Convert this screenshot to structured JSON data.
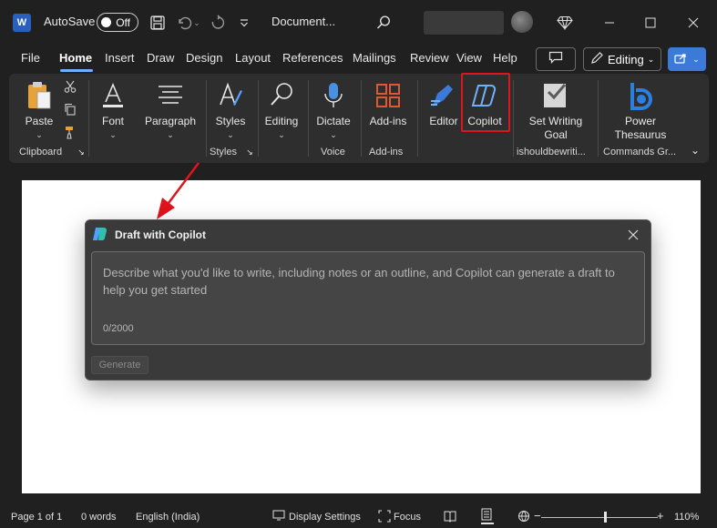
{
  "titlebar": {
    "app_logo": "W",
    "autosave_label": "AutoSave",
    "autosave_state": "Off",
    "doc_title": "Document...",
    "icons": [
      "save-icon",
      "undo-icon",
      "redo-icon",
      "customize-qat-icon",
      "search-icon",
      "premium-diamond-icon",
      "minimize-icon",
      "maximize-icon",
      "close-icon"
    ]
  },
  "tabs": [
    "File",
    "Home",
    "Insert",
    "Draw",
    "Design",
    "Layout",
    "References",
    "Mailings",
    "Review",
    "View",
    "Help"
  ],
  "active_tab": "Home",
  "toolbar_right": {
    "editing_label": "Editing"
  },
  "ribbon": {
    "paste": "Paste",
    "font": "Font",
    "paragraph": "Paragraph",
    "styles": "Styles",
    "editing": "Editing",
    "dictate": "Dictate",
    "addins": "Add-ins",
    "editor": "Editor",
    "copilot": "Copilot",
    "set_writing_goal_1": "Set Writing",
    "set_writing_goal_2": "Goal",
    "power_thesaurus_1": "Power",
    "power_thesaurus_2": "Thesaurus",
    "groups": {
      "clipboard": "Clipboard",
      "styles": "Styles",
      "voice": "Voice",
      "addins": "Add-ins",
      "ishouldbewriting": "ishouldbewriti...",
      "commands": "Commands Gr..."
    }
  },
  "dialog": {
    "title": "Draft with Copilot",
    "placeholder": "Describe what you'd like to write, including notes or an outline, and Copilot can generate a draft to help you get started",
    "char_count": "0/2000",
    "generate_label": "Generate"
  },
  "status": {
    "page": "Page 1 of 1",
    "words": "0 words",
    "language": "English (India)",
    "display_settings": "Display Settings",
    "focus": "Focus",
    "zoom": "110%"
  },
  "colors": {
    "copilot_highlight": "#e0141c",
    "arrow": "#e0141c",
    "accent": "#3b7ad9"
  }
}
